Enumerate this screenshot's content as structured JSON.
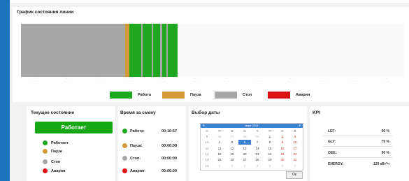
{
  "colors": {
    "work": "#1fa81f",
    "pause": "#d49a3a",
    "stop": "#a7a7a7",
    "alarm": "#dd1111",
    "accent": "#1e73be",
    "run_button": "#16a716",
    "calendar_header": "#3c80d0",
    "selected_day": "#3c80d0"
  },
  "line_chart": {
    "title": "График состояния линии",
    "segments": [
      {
        "state": "stop",
        "start": 0.0,
        "end": 0.272
      },
      {
        "state": "pause",
        "start": 0.272,
        "end": 0.283
      },
      {
        "state": "work",
        "start": 0.283,
        "end": 0.314
      },
      {
        "state": "stop",
        "start": 0.314,
        "end": 0.317
      },
      {
        "state": "work",
        "start": 0.317,
        "end": 0.341
      },
      {
        "state": "stop",
        "start": 0.341,
        "end": 0.345
      },
      {
        "state": "work",
        "start": 0.345,
        "end": 0.364
      },
      {
        "state": "stop",
        "start": 0.364,
        "end": 0.368
      },
      {
        "state": "work",
        "start": 0.368,
        "end": 0.38
      },
      {
        "state": "stop",
        "start": 0.38,
        "end": 0.383
      },
      {
        "state": "work",
        "start": 0.383,
        "end": 0.408
      }
    ],
    "tick_count": 12,
    "legend": [
      {
        "state": "work",
        "label": "Работа"
      },
      {
        "state": "pause",
        "label": "Пауза"
      },
      {
        "state": "stop",
        "label": "Стоп"
      },
      {
        "state": "alarm",
        "label": "Авария"
      }
    ]
  },
  "current_state": {
    "title": "Текущее состояние",
    "button_label": "Работает",
    "items": [
      {
        "label": "Работает",
        "state": "work"
      },
      {
        "label": "Пауза",
        "state": "pause"
      },
      {
        "label": "Стоп",
        "state": "stop"
      },
      {
        "label": "Авария",
        "state": "alarm"
      }
    ]
  },
  "shift_time": {
    "title": "Время за смену",
    "items": [
      {
        "label": "Работа:",
        "value": "00:10:57",
        "state": "work"
      },
      {
        "label": "Пауза:",
        "value": "00:00:00",
        "state": "pause"
      },
      {
        "label": "Стоп:",
        "value": "00:00:00",
        "state": "stop"
      },
      {
        "label": "Авария:",
        "value": "00:00:00",
        "state": "alarm"
      }
    ]
  },
  "date_picker": {
    "title": "Выбор даты",
    "month_label": "март 2024",
    "prev": "«",
    "next": "»",
    "weekdays": [
      "Н",
      "П",
      "В",
      "С",
      "Ч",
      "П",
      "С",
      "В"
    ],
    "rows": [
      [
        "9",
        "26",
        "27",
        "28",
        "29",
        "1",
        "2",
        "3"
      ],
      [
        "10",
        "4",
        "5",
        "6",
        "7",
        "8",
        "9",
        "10"
      ],
      [
        "11",
        "11",
        "12",
        "13",
        "14",
        "15",
        "16",
        "17"
      ],
      [
        "12",
        "18",
        "19",
        "20",
        "21",
        "22",
        "23",
        "24"
      ],
      [
        "13",
        "25",
        "26",
        "27",
        "28",
        "29",
        "30",
        "31"
      ],
      [
        "14",
        "1",
        "2",
        "3",
        "4",
        "5",
        "6",
        "7"
      ]
    ],
    "selected": {
      "row": 1,
      "col": 3
    },
    "ok_label": "Ок"
  },
  "kpi": {
    "title": "KPI",
    "items": [
      {
        "label": "LEF:",
        "value": "96 %"
      },
      {
        "label": "GLY:",
        "value": "79 %"
      },
      {
        "label": "OEE:",
        "value": "90 %"
      },
      {
        "label": "ENERGY:",
        "value": "129 кВт*ч"
      }
    ]
  }
}
